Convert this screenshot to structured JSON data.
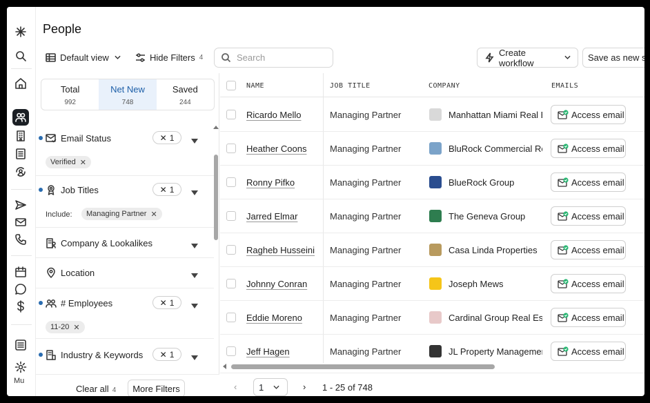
{
  "page": {
    "title": "People"
  },
  "toolbar": {
    "view_label": "Default view",
    "hide_filters_label": "Hide Filters",
    "hide_filters_count": "4",
    "search_placeholder": "Search",
    "create_workflow_label": "Create workflow",
    "save_as_new_label": "Save as new se"
  },
  "rail": {
    "user_initials": "Mu",
    "icons": [
      "sparkle-logo-icon",
      "search-icon",
      "home-icon",
      "people-icon",
      "building-icon",
      "list-icon",
      "refresh-user-icon",
      "send-icon",
      "mail-icon",
      "phone-icon",
      "calendar-icon",
      "chat-icon",
      "dollar-icon",
      "panel-icon",
      "gear-icon"
    ]
  },
  "tabs": [
    {
      "label": "Total",
      "count": "992"
    },
    {
      "label": "Net New",
      "count": "748",
      "selected": true
    },
    {
      "label": "Saved",
      "count": "244"
    }
  ],
  "filters": {
    "email_status": {
      "label": "Email Status",
      "count": "1",
      "chip": "Verified"
    },
    "job_titles": {
      "label": "Job Titles",
      "count": "1",
      "include_label": "Include:",
      "chip": "Managing Partner"
    },
    "company": {
      "label": "Company & Lookalikes"
    },
    "location": {
      "label": "Location"
    },
    "employees": {
      "label": "# Employees",
      "count": "1",
      "chip": "11-20"
    },
    "industry": {
      "label": "Industry & Keywords",
      "count": "1"
    },
    "count_prefix": "✕"
  },
  "panel_footer": {
    "clear_label": "Clear all",
    "clear_count": "4",
    "more_label": "More Filters"
  },
  "table": {
    "headers": {
      "name": "NAME",
      "job": "JOB TITLE",
      "company": "COMPANY",
      "emails": "EMAILS"
    },
    "access_label": "Access email",
    "rows": [
      {
        "name": "Ricardo Mello",
        "job": "Managing Partner",
        "company": "Manhattan Miami Real E",
        "logo_color": "#d9d9d9"
      },
      {
        "name": "Heather Coons",
        "job": "Managing Partner",
        "company": "BluRock Commercial Rea",
        "logo_color": "#7ba3c9"
      },
      {
        "name": "Ronny Pifko",
        "job": "Managing Partner",
        "company": "BlueRock Group",
        "logo_color": "#2a4d8f"
      },
      {
        "name": "Jarred Elmar",
        "job": "Managing Partner",
        "company": "The Geneva Group",
        "logo_color": "#2e7d4f"
      },
      {
        "name": "Ragheb Husseini",
        "job": "Managing Partner",
        "company": "Casa Linda Properties",
        "logo_color": "#b89a5e"
      },
      {
        "name": "Johnny Conran",
        "job": "Managing Partner",
        "company": "Joseph Mews",
        "logo_color": "#f5c518"
      },
      {
        "name": "Eddie Moreno",
        "job": "Managing Partner",
        "company": "Cardinal Group Real Esta",
        "logo_color": "#e8c9c9"
      },
      {
        "name": "Jeff Hagen",
        "job": "Managing Partner",
        "company": "JL Property Managemen",
        "logo_color": "#333333"
      }
    ]
  },
  "pager": {
    "prev": "‹",
    "page": "1",
    "next": "›",
    "range": "1 - 25 of 748"
  },
  "colors": {
    "accent": "#1d5fa8",
    "tab_selected_bg": "#e9f1fb",
    "dot": "#2a6cb0",
    "check_green": "#2bb673"
  }
}
